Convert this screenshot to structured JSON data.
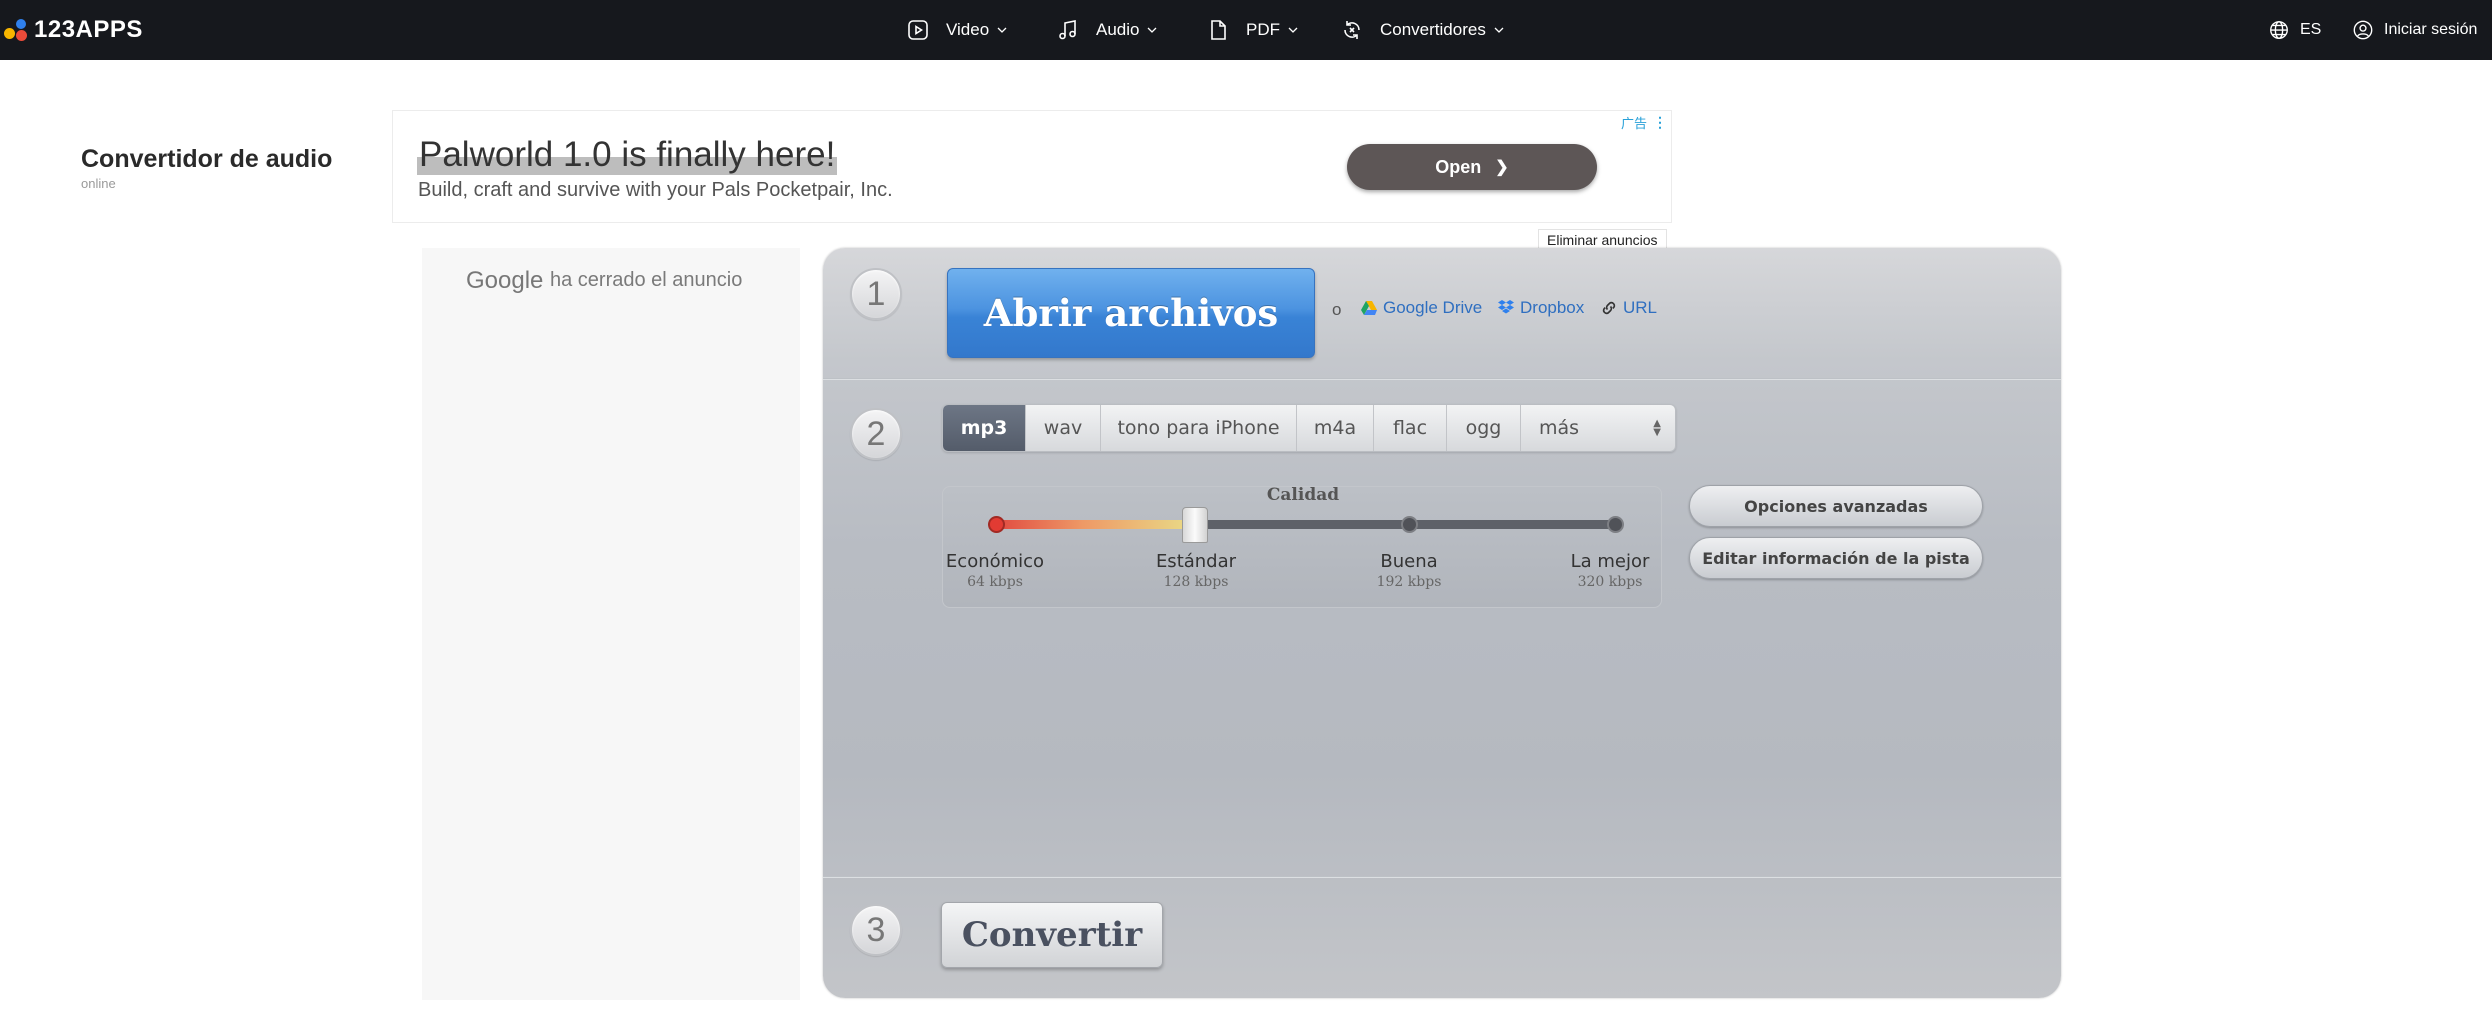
{
  "header": {
    "logo_text": "123APPS",
    "nav": [
      {
        "label": "Video",
        "icon": "video-icon"
      },
      {
        "label": "Audio",
        "icon": "music-note-icon"
      },
      {
        "label": "PDF",
        "icon": "document-icon"
      },
      {
        "label": "Convertidores",
        "icon": "convert-icon"
      }
    ],
    "language": "ES",
    "login": "Iniciar sesión"
  },
  "app": {
    "title": "Convertidor de audio",
    "subtitle": "online"
  },
  "ad": {
    "headline": "Palworld 1.0 is finally here!",
    "body": "Build, craft and survive with your Pals Pocketpair, Inc.",
    "open_label": "Open",
    "tag": "广告",
    "remove_ads": "Eliminar anuncios"
  },
  "closed_ad": {
    "brand": "Google",
    "text": "ha cerrado el anuncio"
  },
  "step1": {
    "number": "1",
    "open_files": "Abrir archivos",
    "or": "o",
    "sources": [
      "Google Drive",
      "Dropbox",
      "URL"
    ]
  },
  "step2": {
    "number": "2",
    "formats": [
      "mp3",
      "wav",
      "tono para iPhone",
      "m4a",
      "flac",
      "ogg",
      "más"
    ],
    "selected_format": "mp3",
    "quality_title": "Calidad",
    "quality_levels": [
      {
        "label": "Económico",
        "bitrate": "64 kbps"
      },
      {
        "label": "Estándar",
        "bitrate": "128 kbps"
      },
      {
        "label": "Buena",
        "bitrate": "192 kbps"
      },
      {
        "label": "La mejor",
        "bitrate": "320 kbps"
      }
    ],
    "selected_quality": "Estándar",
    "advanced_options": "Opciones avanzadas",
    "edit_track_info": "Editar información de la pista"
  },
  "step3": {
    "number": "3",
    "convert": "Convertir"
  },
  "colors": {
    "topbar": "#16181d",
    "open_button": "#4c93e0",
    "link": "#2f6fc0",
    "active_format": "#5f6776",
    "slider_low": "#e0463f"
  }
}
